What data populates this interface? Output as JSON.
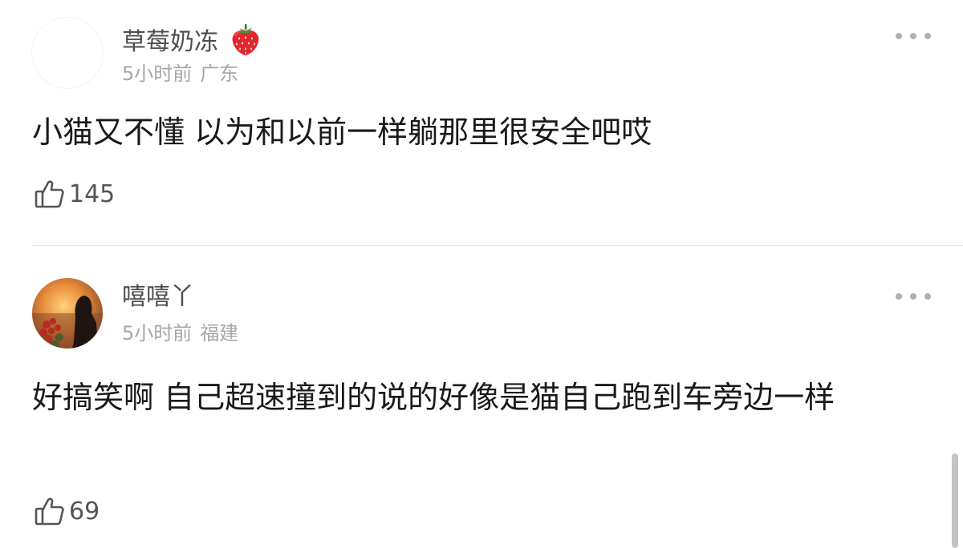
{
  "comments": [
    {
      "username": "草莓奶冻",
      "badge_icon": "strawberry-icon",
      "time": "5小时前",
      "location": "广东",
      "text": "小猫又不懂 以为和以前一样躺那里很安全吧哎",
      "likes": "145"
    },
    {
      "username": "嘻嘻丫",
      "avatar_icon": "girl-silhouette-sunset-avatar",
      "time": "5小时前",
      "location": "福建",
      "text": "好搞笑啊 自己超速撞到的说的好像是猫自己跑到车旁边一样",
      "likes": "69"
    }
  ],
  "icons": {
    "like": "thumbs-up-icon",
    "more": "more-dots-icon"
  },
  "colors": {
    "username": "#4d4d4d",
    "meta": "#a6a6a6",
    "text": "#1a1a1a",
    "divider": "#e6e6e6"
  }
}
